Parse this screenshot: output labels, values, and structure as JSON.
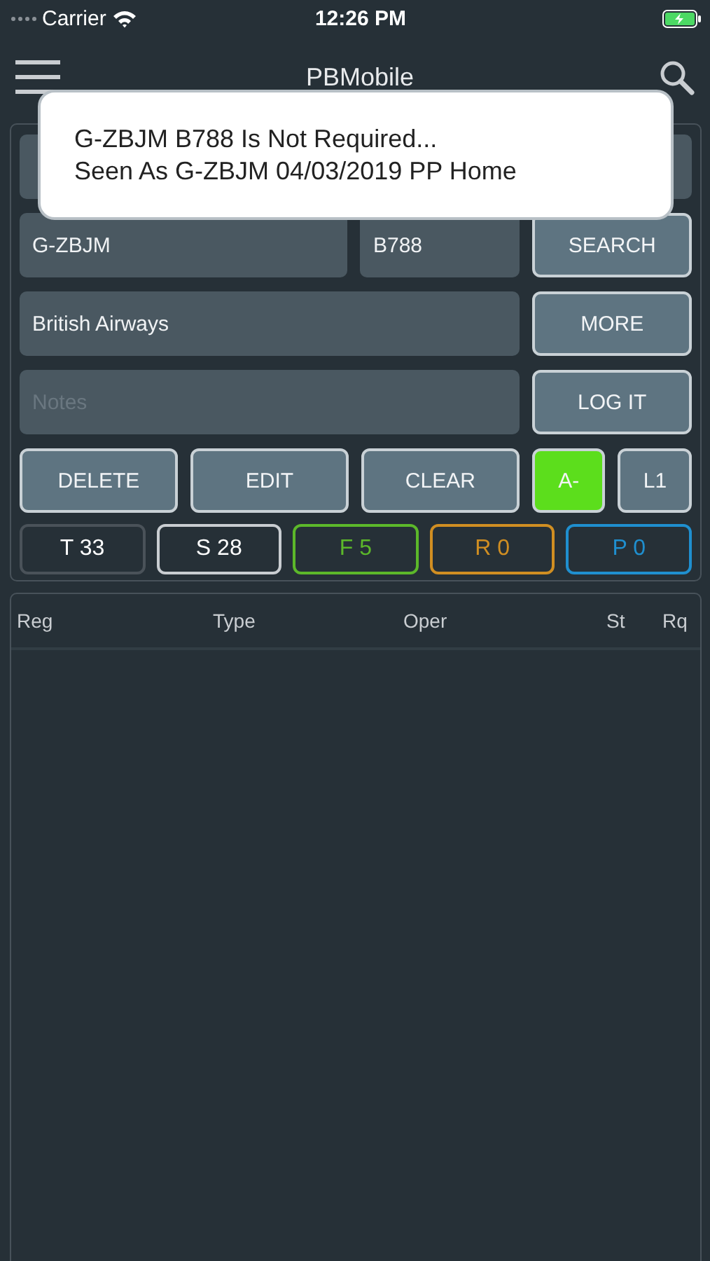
{
  "status_bar": {
    "carrier": "Carrier",
    "time": "12:26 PM"
  },
  "nav": {
    "title": "PBMobile"
  },
  "alert": {
    "lines": [
      "G-ZBJM B788 Is Not Required...",
      "Seen As G-ZBJM 04/03/2019 PP Home"
    ]
  },
  "form": {
    "registration": "G-ZBJM",
    "type": "B788",
    "operator": "British Airways",
    "notes_placeholder": "Notes"
  },
  "side_buttons": [
    "SEARCH",
    "MORE",
    "LOG IT"
  ],
  "action_buttons": [
    "DELETE",
    "EDIT",
    "CLEAR"
  ],
  "toggles": [
    {
      "label": "A-",
      "selected": true
    },
    {
      "label": "L1",
      "selected": false
    }
  ],
  "counters": [
    {
      "label": "T 33",
      "kind": "count",
      "color": "#4a5259"
    },
    {
      "label": "S 28",
      "kind": "count",
      "color": "#c9cdd1"
    },
    {
      "label": "F 5",
      "kind": "filter",
      "color": "#5cb82a"
    },
    {
      "label": "R 0",
      "kind": "filter",
      "color": "#d08e22"
    },
    {
      "label": "P 0",
      "kind": "filter",
      "color": "#1f8fcf"
    }
  ],
  "table": {
    "columns": [
      "Reg",
      "Type",
      "Oper",
      "St",
      "Rq"
    ]
  }
}
